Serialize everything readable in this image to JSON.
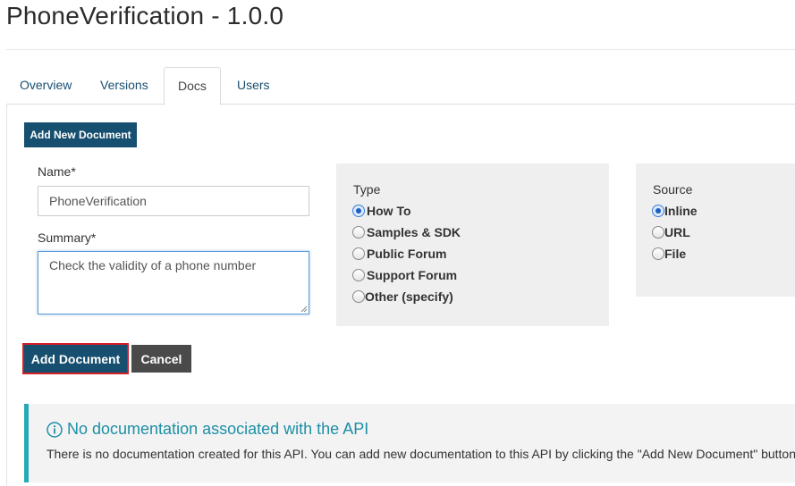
{
  "page": {
    "title": "PhoneVerification - 1.0.0"
  },
  "tabs": [
    {
      "label": "Overview",
      "active": false
    },
    {
      "label": "Versions",
      "active": false
    },
    {
      "label": "Docs",
      "active": true
    },
    {
      "label": "Users",
      "active": false
    }
  ],
  "toolbar": {
    "add_new_document_label": "Add New Document"
  },
  "form": {
    "name_label": "Name*",
    "name_value": "PhoneVerification",
    "summary_label": "Summary*",
    "summary_value": "Check the validity of a phone number",
    "type": {
      "title": "Type",
      "options": [
        {
          "label": "How To",
          "checked": true
        },
        {
          "label": "Samples & SDK",
          "checked": false
        },
        {
          "label": "Public Forum",
          "checked": false
        },
        {
          "label": "Support Forum",
          "checked": false
        },
        {
          "label": "Other (specify)",
          "checked": false
        }
      ]
    },
    "source": {
      "title": "Source",
      "options": [
        {
          "label": "Inline",
          "checked": true
        },
        {
          "label": "URL",
          "checked": false
        },
        {
          "label": "File",
          "checked": false
        }
      ]
    },
    "add_document_label": "Add Document",
    "cancel_label": "Cancel"
  },
  "notice": {
    "icon": "info-circle-icon",
    "title": "No documentation associated with the API",
    "text": "There is no documentation created for this API. You can add new documentation to this API by clicking the \"Add New Document\" button."
  },
  "colors": {
    "primary": "#164f6f",
    "tab_link": "#1b4e72",
    "info_accent": "#27aab5",
    "info_title": "#1d8fa6",
    "focus_outline": "#d41f26"
  }
}
